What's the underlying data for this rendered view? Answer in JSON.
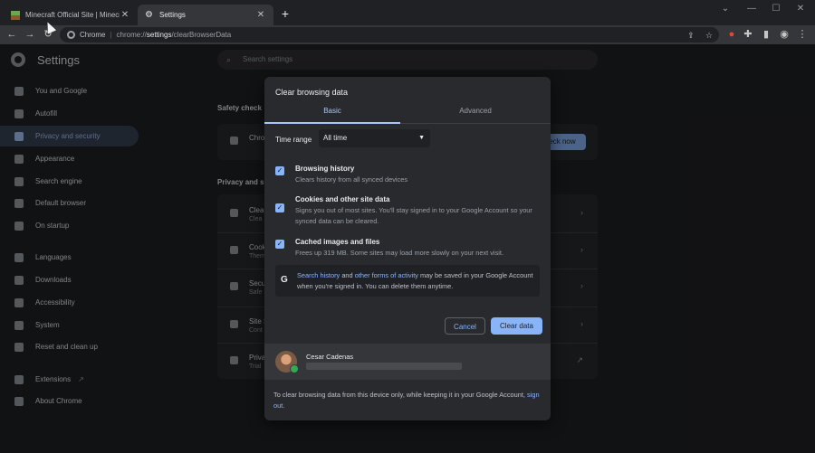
{
  "tabs": [
    {
      "label": "Minecraft Official Site | Minecraft",
      "active": false
    },
    {
      "label": "Settings",
      "active": true
    }
  ],
  "toolbar": {
    "chip": "Chrome",
    "url_scheme": "chrome://",
    "url_host": "settings",
    "url_path": "/clearBrowserData"
  },
  "settings": {
    "title": "Settings",
    "search_placeholder": "Search settings",
    "nav": [
      {
        "label": "You and Google",
        "icon": "person-icon"
      },
      {
        "label": "Autofill",
        "icon": "clipboard-icon"
      },
      {
        "label": "Privacy and security",
        "icon": "shield-icon",
        "selected": true
      },
      {
        "label": "Appearance",
        "icon": "palette-icon"
      },
      {
        "label": "Search engine",
        "icon": "search-icon"
      },
      {
        "label": "Default browser",
        "icon": "browser-icon"
      },
      {
        "label": "On startup",
        "icon": "power-icon"
      },
      {
        "label": "Languages",
        "icon": "globe-icon"
      },
      {
        "label": "Downloads",
        "icon": "download-icon"
      },
      {
        "label": "Accessibility",
        "icon": "accessibility-icon"
      },
      {
        "label": "System",
        "icon": "wrench-icon"
      },
      {
        "label": "Reset and clean up",
        "icon": "history-icon"
      },
      {
        "label": "Extensions",
        "icon": "puzzle-icon"
      },
      {
        "label": "About Chrome",
        "icon": "chrome-icon"
      }
    ],
    "safety_check_heading": "Safety check",
    "safety_row_label": "Chro",
    "check_now": "eck now",
    "privacy_heading": "Privacy and s",
    "privacy_rows": [
      {
        "label": "Clea",
        "sub": "Clea"
      },
      {
        "label": "Cook",
        "sub": "Them"
      },
      {
        "label": "Secu",
        "sub": "Safe"
      },
      {
        "label": "Site S",
        "sub": "Cont"
      },
      {
        "label": "Priva",
        "sub": "Trial"
      }
    ]
  },
  "dialog": {
    "title": "Clear browsing data",
    "tabs": {
      "basic": "Basic",
      "advanced": "Advanced"
    },
    "time_range_label": "Time range",
    "time_range_value": "All time",
    "options": [
      {
        "title": "Browsing history",
        "sub": "Clears history from all synced devices",
        "checked": true
      },
      {
        "title": "Cookies and other site data",
        "sub": "Signs you out of most sites. You'll stay signed in to your Google Account so your synced data can be cleared.",
        "checked": true
      },
      {
        "title": "Cached images and files",
        "sub": "Frees up 319 MB. Some sites may load more slowly on your next visit.",
        "checked": true
      }
    ],
    "google_note": {
      "link1": "Search history",
      "and": "and",
      "link2": "other forms of activity",
      "rest": "may be saved in your Google Account when you're signed in. You can delete them anytime."
    },
    "cancel": "Cancel",
    "clear": "Clear data",
    "account_name": "Cesar Cadenas",
    "footer_text": "To clear browsing data from this device only, while keeping it in your Google Account,",
    "footer_link": "sign out."
  },
  "colors": {
    "accent": "#8ab4f8",
    "surface": "#292a2d",
    "background": "#202124"
  }
}
